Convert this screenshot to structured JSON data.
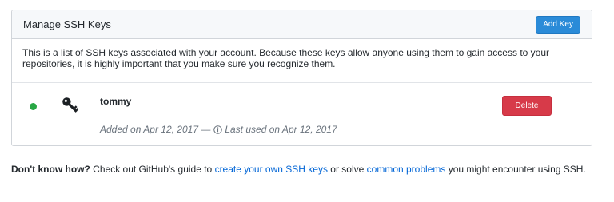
{
  "panel": {
    "title": "Manage SSH Keys",
    "add_button": "Add Key",
    "description": "This is a list of SSH keys associated with your account. Because these keys allow anyone using them to gain access to your repositories, it is highly important that you make sure you recognize them."
  },
  "keys": [
    {
      "title": "tommy",
      "added": "Added on Apr 12, 2017 —",
      "last_used": "Last used on Apr 12, 2017",
      "delete_label": "Delete",
      "status_color": "#28a745"
    }
  ],
  "help": {
    "lead": "Don't know how?",
    "text1": " Check out GitHub's guide to ",
    "link1": "create your own SSH keys",
    "text2": " or solve ",
    "link2": "common problems",
    "text3": " you might encounter using SSH."
  },
  "colors": {
    "accent_blue": "#2a8bd8",
    "danger_red": "#d73a49",
    "link_blue": "#0366d6"
  },
  "icons": {
    "key": "key-icon",
    "status": "status-dot",
    "info": "info-icon"
  }
}
